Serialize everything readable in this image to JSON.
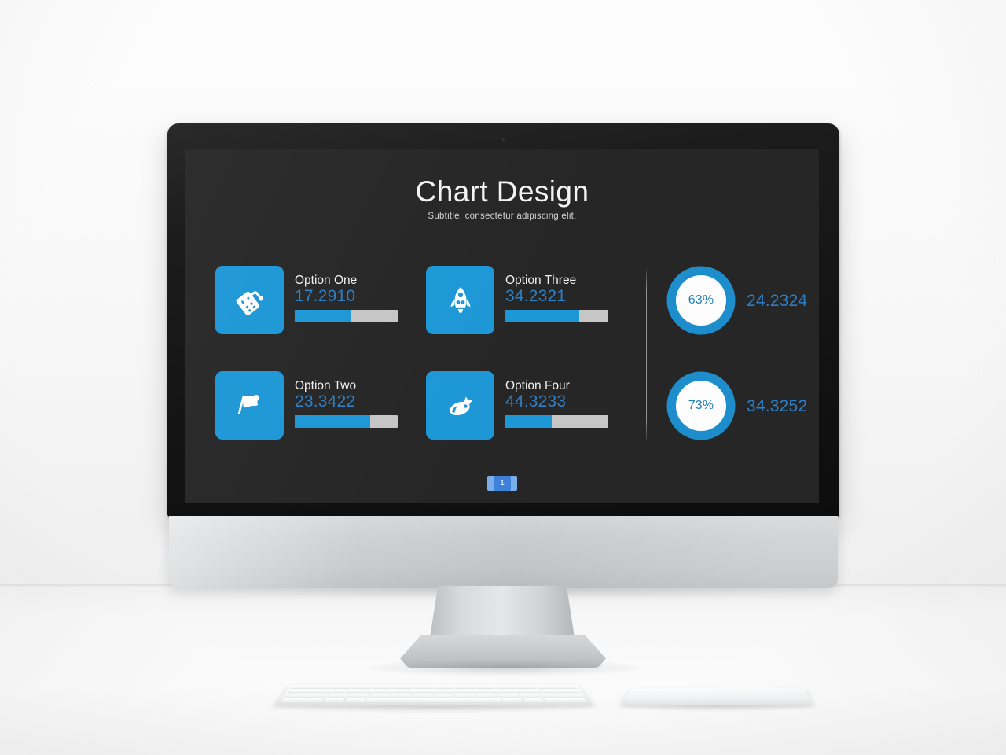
{
  "scene": {
    "device": "desktop-computer",
    "page_indicator": "1"
  },
  "slide": {
    "title": "Chart Design",
    "subtitle": "Subtitle, consectetur  adipiscing elit."
  },
  "colors": {
    "accent": "#1d97d6",
    "value_text": "#2f7fc4",
    "slide_bg": "#262626",
    "bar_track": "#c6c6c6",
    "gauge_ring": "#1d8ecb"
  },
  "chart_data": {
    "type": "bar",
    "title": "Chart Design",
    "subtitle": "Subtitle, consectetur  adipiscing elit.",
    "categories": [
      "Option One",
      "Option Two",
      "Option Three",
      "Option Four"
    ],
    "values": [
      17.291,
      23.3422,
      34.2321,
      44.3233
    ],
    "percents": [
      55,
      73,
      72,
      45
    ],
    "xlabel": "",
    "ylabel": "",
    "ylim": [
      0,
      100
    ],
    "grid": false,
    "legend": "none",
    "gauges": [
      {
        "percent": 63,
        "label": "63%",
        "value": "24.2324"
      },
      {
        "percent": 73,
        "label": "73%",
        "value": "34.3252"
      }
    ]
  },
  "options": [
    {
      "icon": "gamepad-icon",
      "label": "Option One",
      "value": "17.2910",
      "percent": 55
    },
    {
      "icon": "flag-icon",
      "label": "Option Two",
      "value": "23.3422",
      "percent": 73
    },
    {
      "icon": "rocket-icon",
      "label": "Option Three",
      "value": "34.2321",
      "percent": 72
    },
    {
      "icon": "spaceship-icon",
      "label": "Option Four",
      "value": "44.3233",
      "percent": 45
    }
  ],
  "gauges": [
    {
      "percent_label": "63%",
      "percent": 63,
      "value": "24.2324"
    },
    {
      "percent_label": "73%",
      "percent": 73,
      "value": "34.3252"
    }
  ]
}
